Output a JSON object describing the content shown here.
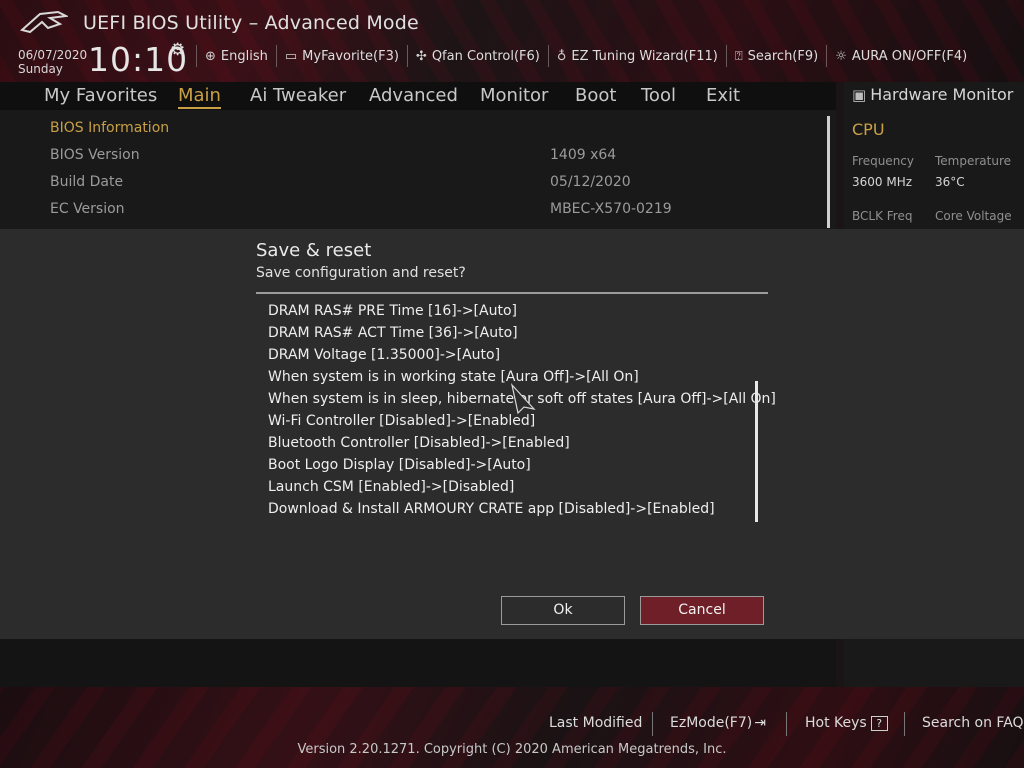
{
  "header": {
    "title": "UEFI BIOS Utility – Advanced Mode",
    "date": "06/07/2020",
    "day": "Sunday",
    "time": "10:10",
    "toolbar": [
      {
        "label": "English",
        "icon": "globe-icon"
      },
      {
        "label": "MyFavorite(F3)",
        "icon": "favorite-icon"
      },
      {
        "label": "Qfan Control(F6)",
        "icon": "fan-icon"
      },
      {
        "label": "EZ Tuning Wizard(F11)",
        "icon": "lightbulb-icon"
      },
      {
        "label": "Search(F9)",
        "icon": "search-icon"
      },
      {
        "label": "AURA ON/OFF(F4)",
        "icon": "aura-icon"
      }
    ]
  },
  "nav": {
    "tabs": [
      "My Favorites",
      "Main",
      "Ai Tweaker",
      "Advanced",
      "Monitor",
      "Boot",
      "Tool",
      "Exit"
    ],
    "active": "Main"
  },
  "main": {
    "section_title": "BIOS Information",
    "rows": [
      {
        "label": "BIOS Version",
        "value": "1409  x64"
      },
      {
        "label": "Build Date",
        "value": "05/12/2020"
      },
      {
        "label": "EC Version",
        "value": "MBEC-X570-0219"
      }
    ]
  },
  "hardware_monitor": {
    "title": "Hardware Monitor",
    "section": "CPU",
    "frequency_label": "Frequency",
    "frequency_value": "3600 MHz",
    "temperature_label": "Temperature",
    "temperature_value": "36°C",
    "bclk_label": "BCLK Freq",
    "core_voltage_label": "Core Voltage"
  },
  "dialog": {
    "title": "Save & reset",
    "subtitle": "Save configuration and reset?",
    "changes": [
      "DRAM RAS# PRE Time [16]->[Auto]",
      "DRAM RAS# ACT Time [36]->[Auto]",
      "DRAM Voltage [1.35000]->[Auto]",
      "When system is in working state [Aura Off]->[All On]",
      "When system is in sleep, hibernate or soft off states [Aura Off]->[All On]",
      "Wi-Fi Controller [Disabled]->[Enabled]",
      "Bluetooth Controller [Disabled]->[Enabled]",
      "Boot Logo Display [Disabled]->[Auto]",
      "Launch CSM [Enabled]->[Disabled]",
      "Download & Install ARMOURY CRATE app [Disabled]->[Enabled]"
    ],
    "ok_label": "Ok",
    "cancel_label": "Cancel"
  },
  "footer": {
    "last_modified": "Last Modified",
    "ezmode": "EzMode(F7)",
    "hot_keys": "Hot Keys",
    "hot_keys_key": "?",
    "faq": "Search on FAQ",
    "version": "Version 2.20.1271. Copyright (C) 2020 American Megatrends, Inc."
  },
  "colors": {
    "accent_gold": "#c9a044",
    "cancel_red": "#6f1f27",
    "brand_red": "#b0121f"
  }
}
